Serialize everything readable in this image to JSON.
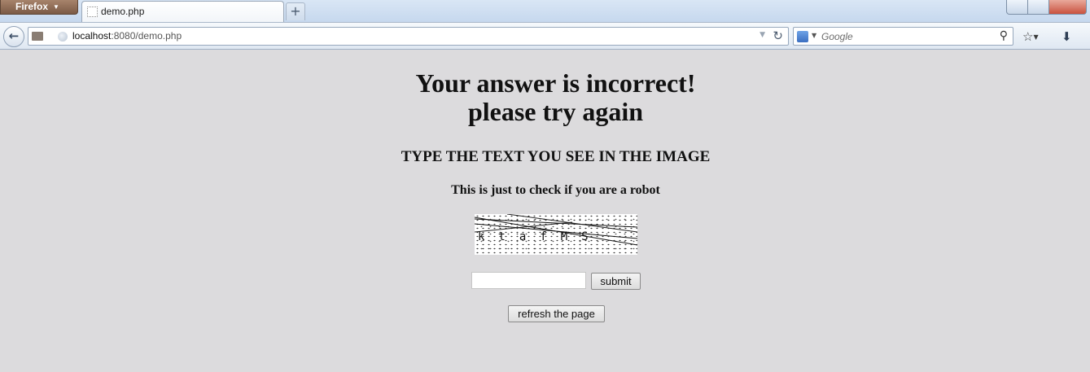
{
  "browser": {
    "menu_label": "Firefox",
    "tab_title": "demo.php",
    "new_tab_label": "+",
    "url_host": "localhost",
    "url_rest": ":8080/demo.php",
    "search_placeholder": "Google"
  },
  "page": {
    "heading_line1": "Your answer is incorrect!",
    "heading_line2": "please try again",
    "instruction": "TYPE THE TEXT YOU SEE IN THE IMAGE",
    "subtext": "This is just to check if you are a robot",
    "captcha_text": "ktafMS",
    "answer_value": "",
    "submit_label": "submit",
    "refresh_label": "refresh the page"
  }
}
